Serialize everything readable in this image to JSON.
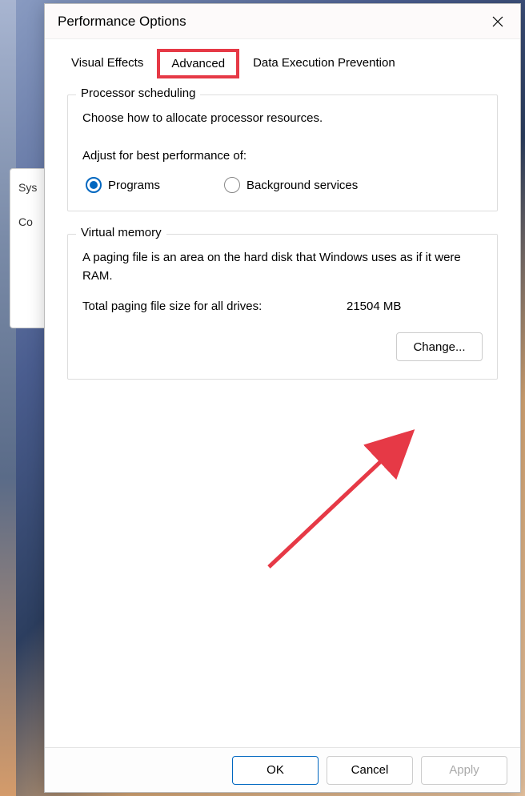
{
  "dialog": {
    "title": "Performance Options"
  },
  "tabs": {
    "visual_effects": "Visual Effects",
    "advanced": "Advanced",
    "dep": "Data Execution Prevention"
  },
  "processor": {
    "group_title": "Processor scheduling",
    "description": "Choose how to allocate processor resources.",
    "adjust_label": "Adjust for best performance of:",
    "option_programs": "Programs",
    "option_background": "Background services"
  },
  "virtual_memory": {
    "group_title": "Virtual memory",
    "description": "A paging file is an area on the hard disk that Windows uses as if it were RAM.",
    "total_label": "Total paging file size for all drives:",
    "total_value": "21504 MB",
    "change_button": "Change..."
  },
  "footer": {
    "ok": "OK",
    "cancel": "Cancel",
    "apply": "Apply"
  },
  "background": {
    "partial_tab1": "Sys",
    "partial_tab2": "Co"
  }
}
